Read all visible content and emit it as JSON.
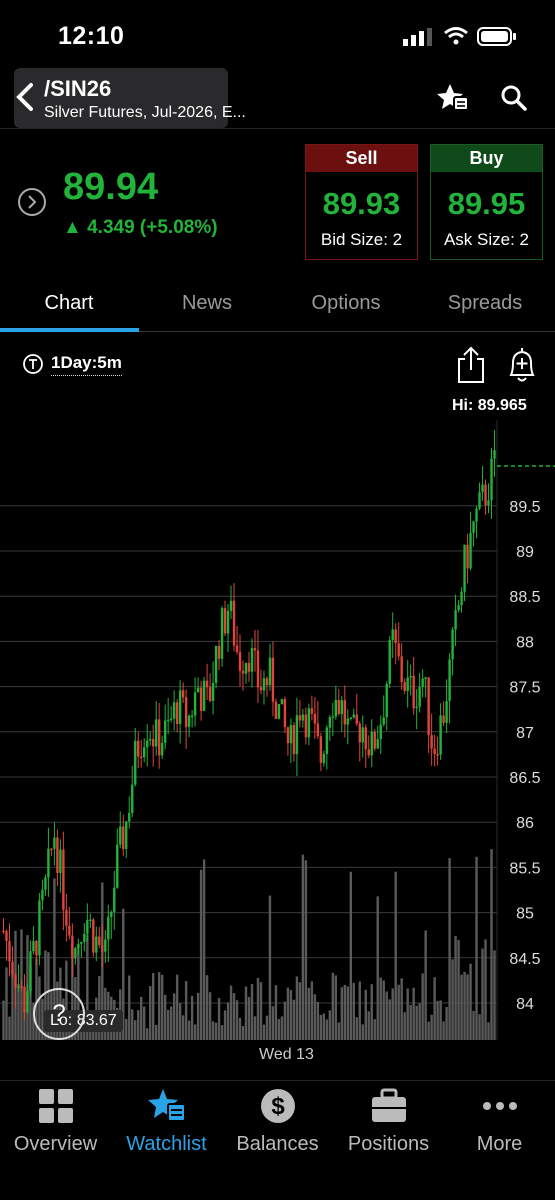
{
  "status_bar": {
    "time": "12:10"
  },
  "header": {
    "symbol": "/SIN26",
    "description": "Silver Futures, Jul-2026, E...",
    "icons": [
      "back-icon",
      "watchlist-star-icon",
      "search-icon"
    ]
  },
  "quote": {
    "last": "89.94",
    "change": "4.349 (+5.08%)",
    "sell": {
      "label": "Sell",
      "price": "89.93",
      "size": "Bid Size: 2"
    },
    "buy": {
      "label": "Buy",
      "price": "89.95",
      "size": "Ask Size: 2"
    }
  },
  "tabs": [
    {
      "label": "Chart",
      "active": true
    },
    {
      "label": "News",
      "active": false
    },
    {
      "label": "Options",
      "active": false
    },
    {
      "label": "Spreads",
      "active": false
    }
  ],
  "chart_toolbar": {
    "timeframe": "1Day:5m"
  },
  "chart_data": {
    "type": "candlestick",
    "hi_label": "Hi: 89.965",
    "lo_label": "Lo: 83.67",
    "date_label": "Wed 13",
    "help_label": "?",
    "y_ticks": [
      89.5,
      89,
      88.5,
      88,
      87.5,
      87,
      86.5,
      86,
      85.5,
      85,
      84.5,
      84
    ],
    "y_tick_labels": [
      "89.5",
      "89",
      "88.5",
      "88",
      "87.5",
      "87",
      "86.5",
      "86",
      "85.5",
      "85",
      "84.5",
      "84"
    ],
    "high": 89.965,
    "low": 83.67,
    "last": 89.94,
    "price_path": [
      84.8,
      84.4,
      84.0,
      84.6,
      85.2,
      85.9,
      85.1,
      84.6,
      85.0,
      84.7,
      84.5,
      85.5,
      86.0,
      86.8,
      87.1,
      86.9,
      87.0,
      87.3,
      87.1,
      87.5,
      87.3,
      88.0,
      88.4,
      87.8,
      87.9,
      87.5,
      87.6,
      87.2,
      86.8,
      87.3,
      87.1,
      86.7,
      87.4,
      87.3,
      86.9,
      87.1,
      86.8,
      87.2,
      88.0,
      87.6,
      87.4,
      87.6,
      86.8,
      87.2,
      88.0,
      88.8,
      89.3,
      89.6,
      89.94
    ],
    "colors": {
      "up": "#22b33a",
      "down": "#e0453a",
      "grid": "#3a3a3a",
      "volume": "#5a5a5a"
    }
  },
  "bottom_nav": [
    {
      "label": "Overview",
      "icon": "overview-icon",
      "active": false
    },
    {
      "label": "Watchlist",
      "icon": "watchlist-icon",
      "active": true
    },
    {
      "label": "Balances",
      "icon": "balances-icon",
      "active": false
    },
    {
      "label": "Positions",
      "icon": "positions-icon",
      "active": false
    },
    {
      "label": "More",
      "icon": "more-icon",
      "active": false
    }
  ]
}
